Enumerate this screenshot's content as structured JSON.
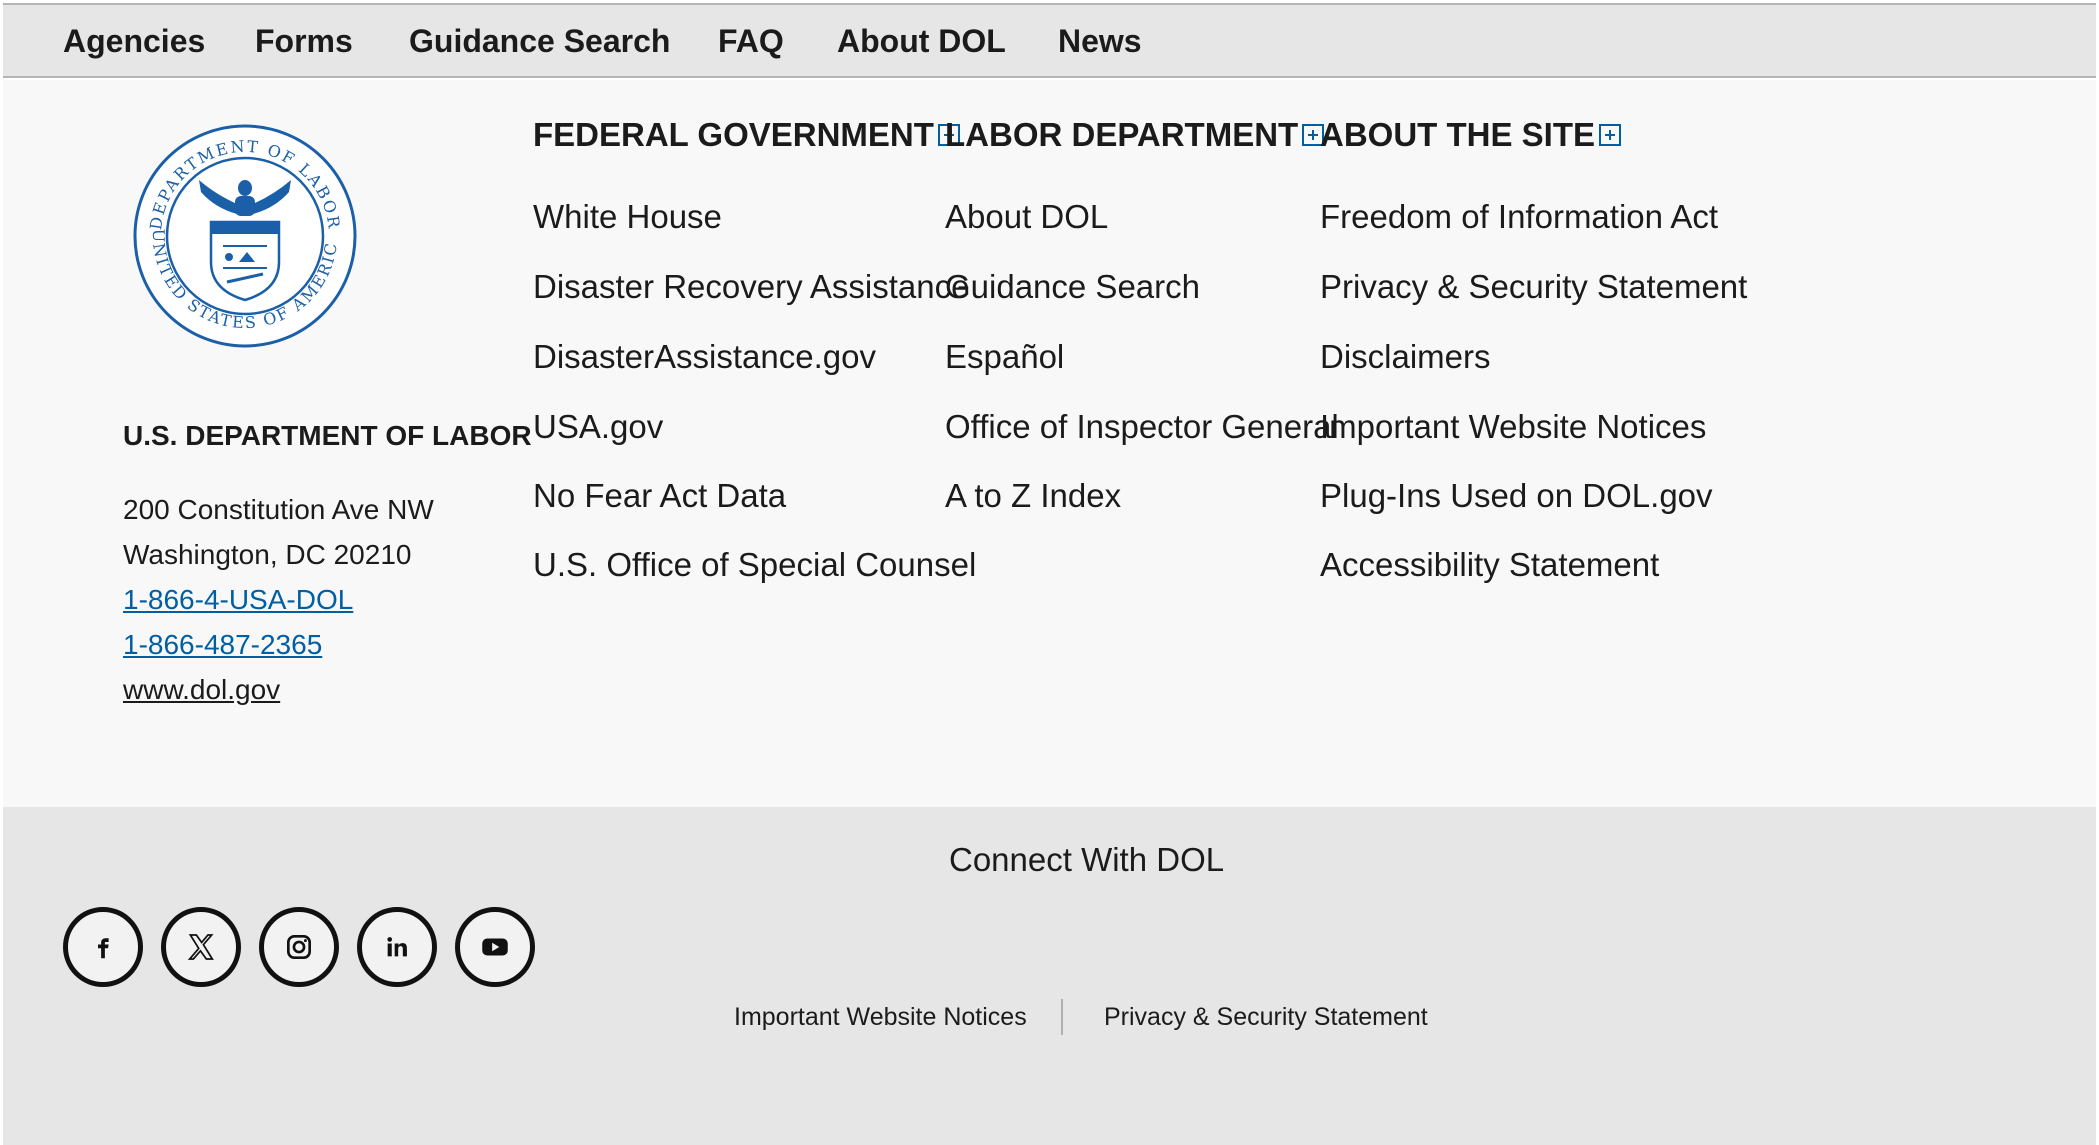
{
  "topnav": {
    "items": [
      "Agencies",
      "Forms",
      "Guidance Search",
      "FAQ",
      "About DOL",
      "News"
    ]
  },
  "org": {
    "seal_text": [
      "DEPARTMENT OF LABOR",
      "UNITED STATES OF AMERICA"
    ],
    "name": "U.S. DEPARTMENT OF LABOR",
    "address_line1": "200 Constitution Ave NW",
    "address_line2": "Washington, DC 20210",
    "phone1": "1-866-4-USA-DOL",
    "phone2": "1-866-487-2365",
    "website": "www.dol.gov"
  },
  "columns": [
    {
      "heading": "FEDERAL GOVERNMENT",
      "links": [
        "White House",
        "Disaster Recovery Assistance",
        "DisasterAssistance.gov",
        "USA.gov",
        "No Fear Act Data",
        "U.S. Office of Special Counsel"
      ]
    },
    {
      "heading": "LABOR DEPARTMENT",
      "links": [
        "About DOL",
        "Guidance Search",
        "Español",
        "Office of Inspector General",
        "A to Z Index"
      ]
    },
    {
      "heading": "ABOUT THE SITE",
      "links": [
        "Freedom of Information Act",
        "Privacy & Security Statement",
        "Disclaimers",
        "Important Website Notices",
        "Plug-Ins Used on DOL.gov",
        "Accessibility Statement"
      ]
    }
  ],
  "connect": {
    "title": "Connect With DOL",
    "social": [
      "facebook-icon",
      "x-icon",
      "instagram-icon",
      "linkedin-icon",
      "youtube-icon"
    ]
  },
  "footer_links": [
    "Important Website Notices",
    "Privacy & Security Statement"
  ],
  "colors": {
    "link_blue": "#005ea2",
    "nav_bg": "#e6e6e6",
    "middle_bg": "#f8f8f8"
  }
}
